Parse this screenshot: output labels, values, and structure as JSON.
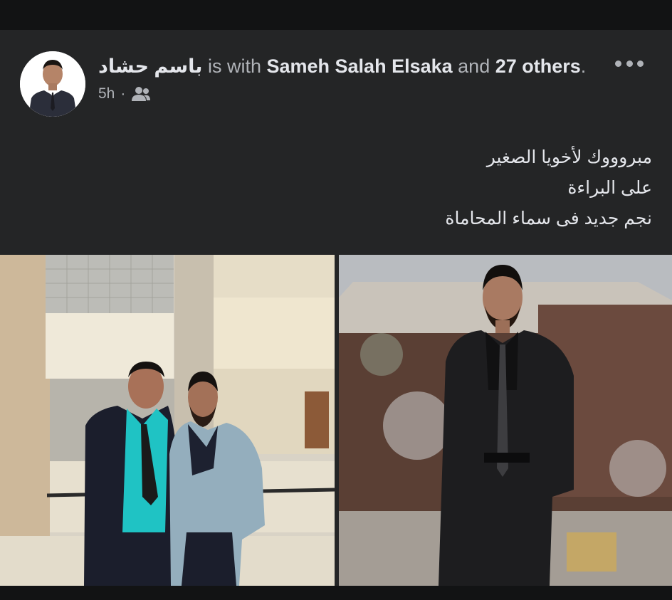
{
  "post": {
    "author_name": "باسم حشاد",
    "with_text": "is with",
    "tagged_person": "Sameh Salah Elsaka",
    "and_text": "and",
    "others_text": "27 others",
    "period": ".",
    "timestamp": "5h",
    "separator": "·",
    "privacy_icon": "friends-icon",
    "more_icon": "more-horizontal-icon",
    "body_lines": [
      "مبروووك لأخويا الصغير",
      "على البراءة",
      "نجم جديد فى سماء المحاماة"
    ],
    "photos": [
      {
        "name": "photo-two-men-in-suits"
      },
      {
        "name": "photo-man-in-black-suit"
      }
    ]
  },
  "colors": {
    "background": "#18191a",
    "card": "#242526",
    "primary_text": "#e4e6eb",
    "secondary_text": "#b0b3b8"
  }
}
